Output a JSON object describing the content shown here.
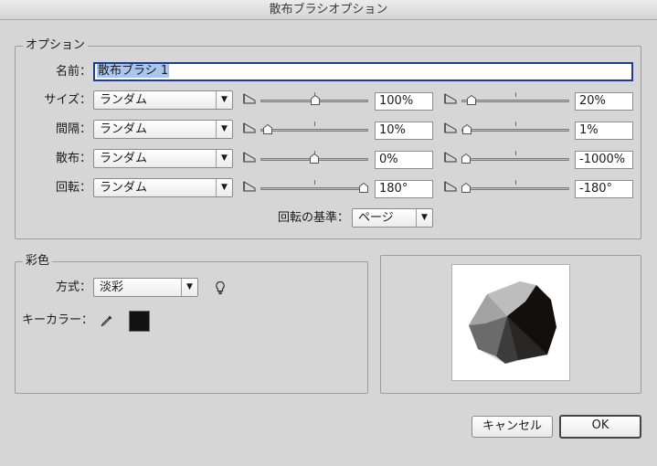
{
  "window": {
    "title": "散布ブラシオプション"
  },
  "options_group": {
    "label": "オプション",
    "name_label": "名前：",
    "name_value": "散布ブラシ 1",
    "rows": [
      {
        "label": "サイズ：",
        "method": "ランダム",
        "min_value": "100%",
        "max_value": "20%",
        "min_pos": 0.51,
        "max_pos": 0.06
      },
      {
        "label": "間隔：",
        "method": "ランダム",
        "min_value": "10%",
        "max_value": "1%",
        "min_pos": 0.03,
        "max_pos": 0.01
      },
      {
        "label": "散布：",
        "method": "ランダム",
        "min_value": "0%",
        "max_value": "-1000%",
        "min_pos": 0.5,
        "max_pos": 0.0
      },
      {
        "label": "回転：",
        "method": "ランダム",
        "min_value": "180°",
        "max_value": "-180°",
        "min_pos": 1.0,
        "max_pos": 0.0
      }
    ],
    "rotation_base_label": "回転の基準：",
    "rotation_base_value": "ページ"
  },
  "coloring_group": {
    "label": "彩色",
    "method_label": "方式：",
    "method_value": "淡彩",
    "key_color_label": "キーカラー：",
    "key_color": "#141111"
  },
  "buttons": {
    "cancel": "キャンセル",
    "ok": "OK"
  },
  "icons": {
    "tip": "lightbulb-icon",
    "eyedropper": "eyedropper-icon",
    "dropdown": "chevron-down-icon"
  }
}
